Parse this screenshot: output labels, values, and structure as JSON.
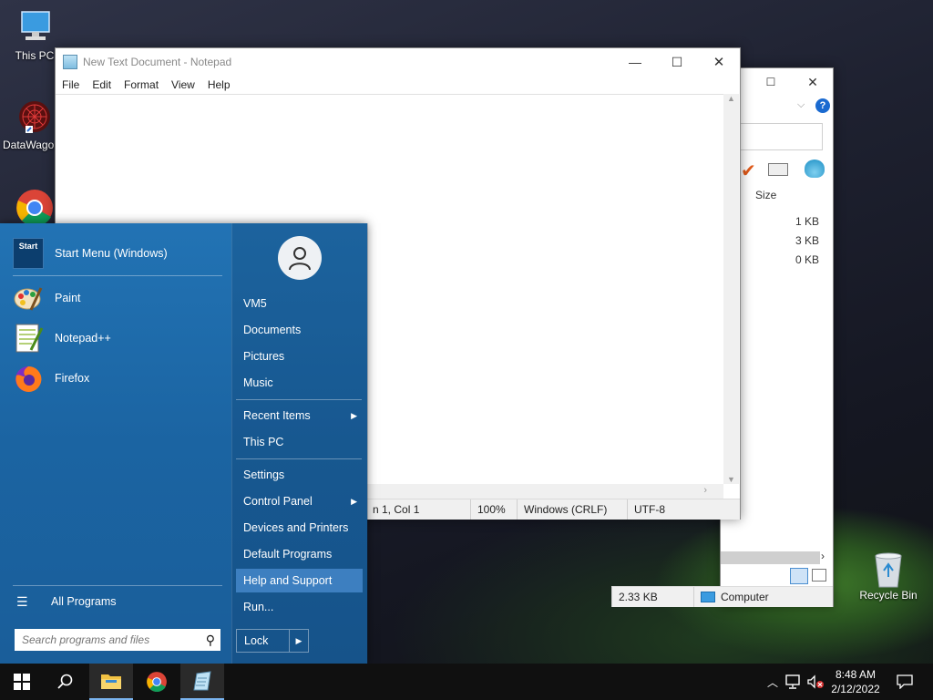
{
  "desktop": {
    "icons": [
      {
        "label": "This PC"
      },
      {
        "label": "DataWagon"
      },
      {
        "label": "Recycle Bin"
      }
    ]
  },
  "explorer_bg": {
    "column_size": "Size",
    "sizes": [
      "1 KB",
      "3 KB",
      "0 KB"
    ],
    "status_size": "2.33 KB",
    "status_location": "Computer"
  },
  "notepad": {
    "title": "New Text Document - Notepad",
    "menu": [
      "File",
      "Edit",
      "Format",
      "View",
      "Help"
    ],
    "status": {
      "position": "n 1, Col 1",
      "zoom": "100%",
      "line_ending": "Windows (CRLF)",
      "encoding": "UTF-8"
    }
  },
  "start_menu": {
    "header_app": {
      "label": "Start Menu (Windows)",
      "icon_text": "Start"
    },
    "programs": [
      {
        "label": "Paint",
        "icon": "paint-icon"
      },
      {
        "label": "Notepad++",
        "icon": "notepadpp-icon"
      },
      {
        "label": "Firefox",
        "icon": "firefox-icon"
      }
    ],
    "all_programs": "All Programs",
    "search_placeholder": "Search programs and files",
    "right_items": {
      "user": "VM5",
      "documents": "Documents",
      "pictures": "Pictures",
      "music": "Music",
      "recent": "Recent Items",
      "thispc": "This PC",
      "settings": "Settings",
      "control_panel": "Control Panel",
      "devices": "Devices and Printers",
      "defaults": "Default Programs",
      "help": "Help and Support",
      "run": "Run..."
    },
    "lock": "Lock",
    "colors": {
      "accent": "#1b64a2",
      "highlight": "#3d7fc0"
    }
  },
  "taskbar": {
    "time": "8:48 AM",
    "date": "2/12/2022"
  }
}
